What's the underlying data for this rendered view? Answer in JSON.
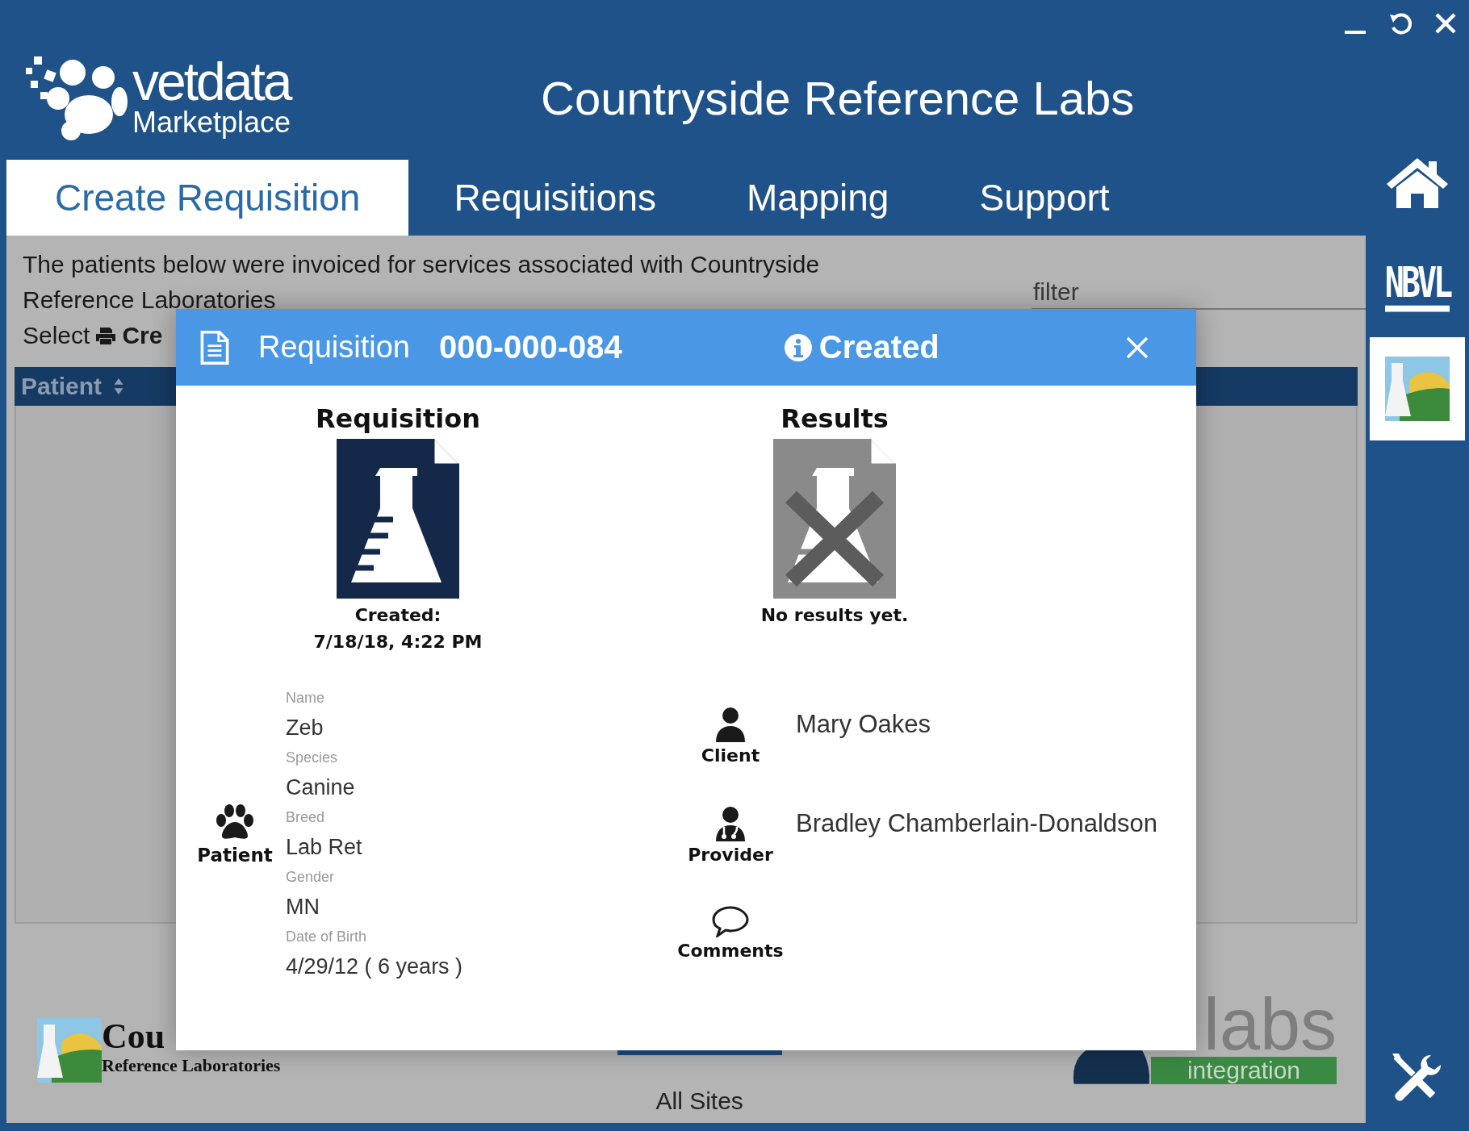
{
  "window_controls": [
    {
      "kind": "minimize"
    },
    {
      "kind": "restore"
    },
    {
      "kind": "close"
    }
  ],
  "header": {
    "logo_name": "vetdata",
    "logo_subtitle": "Marketplace",
    "title": "Countryside Reference Labs"
  },
  "tabs": [
    {
      "label": "Create Requisition",
      "selected": true
    },
    {
      "label": "Requisitions",
      "selected": false
    },
    {
      "label": "Mapping",
      "selected": false
    },
    {
      "label": "Support",
      "selected": false
    }
  ],
  "sidebar": {
    "items": [
      {
        "kind": "home",
        "selected": false
      },
      {
        "kind": "nbvl",
        "label": "NBVL",
        "selected": false
      },
      {
        "kind": "lab",
        "selected": true
      }
    ],
    "bottom_tool": {
      "kind": "tools"
    }
  },
  "intro": {
    "lines": [
      "The patients below were invoiced for services associated with Countryside",
      "Reference Laboratories"
    ],
    "select_label": "Select",
    "select_action": "Cre"
  },
  "filter": {
    "placeholder": "filter"
  },
  "table": {
    "columns": [
      {
        "label": "Patient",
        "sortable": true
      }
    ]
  },
  "footer": {
    "lab_logo": {
      "name": "Cou",
      "subtitle": "Reference Laboratories"
    },
    "site": "All Sites",
    "integration_logo": {
      "name": "labs",
      "subtitle": "integration"
    }
  },
  "modal": {
    "title": "Requisition",
    "number": "000-000-084",
    "status": "Created",
    "requisition": {
      "heading": "Requisition",
      "status_label": "Created:",
      "date": "7/18/18, 4:22 PM"
    },
    "results": {
      "heading": "Results",
      "available": false,
      "message": "No results yet."
    },
    "patient": {
      "label": "Patient",
      "fields": [
        {
          "label": "Name",
          "value": "Zeb"
        },
        {
          "label": "Species",
          "value": "Canine"
        },
        {
          "label": "Breed",
          "value": "Lab Ret"
        },
        {
          "label": "Gender",
          "value": "MN"
        },
        {
          "label": "Date of Birth",
          "value": "4/29/12  ( 6 years  )"
        }
      ]
    },
    "people": [
      {
        "kind": "client",
        "label": "Client",
        "value": "Mary Oakes"
      },
      {
        "kind": "provider",
        "label": "Provider",
        "value": "Bradley Chamberlain-Donaldson"
      },
      {
        "kind": "comments",
        "label": "Comments"
      }
    ]
  }
}
